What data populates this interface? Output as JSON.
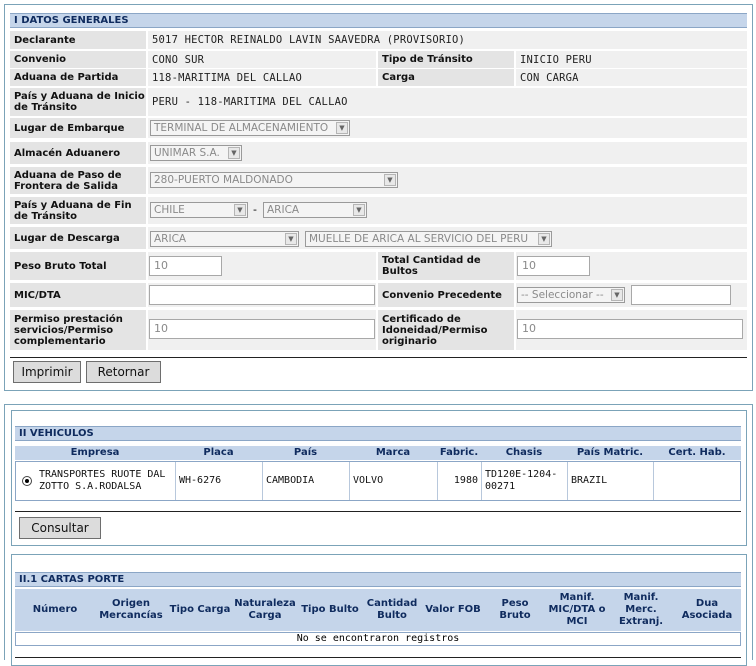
{
  "general": {
    "section_title": "I DATOS GENERALES",
    "declarante_label": "Declarante",
    "declarante_value": "5017 HECTOR REINALDO LAVIN SAAVEDRA (PROVISORIO)",
    "convenio_label": "Convenio",
    "convenio_value": "CONO SUR",
    "tipo_transito_label": "Tipo de Tránsito",
    "tipo_transito_value": "INICIO PERU",
    "aduana_partida_label": "Aduana de Partida",
    "aduana_partida_value": "118-MARITIMA DEL CALLAO",
    "carga_label": "Carga",
    "carga_value": "CON CARGA",
    "pais_aduana_inicio_label": "País y Aduana de Inicio de Tránsito",
    "pais_aduana_inicio_value": "PERU - 118-MARITIMA DEL CALLAO",
    "lugar_embarque_label": "Lugar de Embarque",
    "lugar_embarque_value": "TERMINAL DE ALMACENAMIENTO",
    "almacen_label": "Almacén Aduanero",
    "almacen_value": "UNIMAR S.A.",
    "aduana_paso_label": "Aduana de Paso de Frontera de Salida",
    "aduana_paso_value": "280-PUERTO MALDONADO",
    "pais_aduana_fin_label": "País y Aduana de Fin de Tránsito",
    "pais_fin_value": "CHILE",
    "fin_separator": "-",
    "aduana_fin_value": "ARICA",
    "lugar_descarga_label": "Lugar de Descarga",
    "lugar_descarga_city": "ARICA",
    "lugar_descarga_place": "MUELLE DE ARICA AL SERVICIO DEL PERU",
    "peso_bruto_label": "Peso Bruto Total",
    "peso_bruto_value": "10",
    "total_bultos_label": "Total Cantidad de Bultos",
    "total_bultos_value": "10",
    "mic_dta_label": "MIC/DTA",
    "mic_dta_value": "",
    "convenio_precedente_label": "Convenio Precedente",
    "convenio_precedente_select": "-- Seleccionar --",
    "convenio_precedente_value": "",
    "permiso_label": "Permiso prestación servicios/Permiso complementario",
    "permiso_value": "10",
    "certificado_label": "Certificado de Idoneidad/Permiso originario",
    "certificado_value": "10",
    "print_button": "Imprimir",
    "back_button": "Retornar"
  },
  "vehiculos": {
    "section_title": "II VEHICULOS",
    "headers": [
      "Empresa",
      "Placa",
      "País",
      "Marca",
      "Fabric.",
      "Chasis",
      "País Matric.",
      "Cert. Hab."
    ],
    "row": {
      "empresa": "TRANSPORTES RUOTE DAL ZOTTO S.A.RODALSA",
      "placa": "WH-6276",
      "pais": "CAMBODIA",
      "marca": "VOLVO",
      "fabric": "1980",
      "chasis": "TD120E-1204-00271",
      "pais_matric": "BRAZIL",
      "cert_hab": ""
    },
    "consult_button": "Consultar"
  },
  "cartas": {
    "section_title": "II.1 CARTAS PORTE",
    "headers": [
      "Número",
      "Origen Mercancías",
      "Tipo Carga",
      "Naturaleza Carga",
      "Tipo Bulto",
      "Cantidad Bulto",
      "Valor FOB",
      "Peso Bruto",
      "Manif. MIC/DTA o MCI",
      "Manif. Merc. Extranj.",
      "Dua Asociada"
    ],
    "empty_message": "No se encontraron registros"
  }
}
